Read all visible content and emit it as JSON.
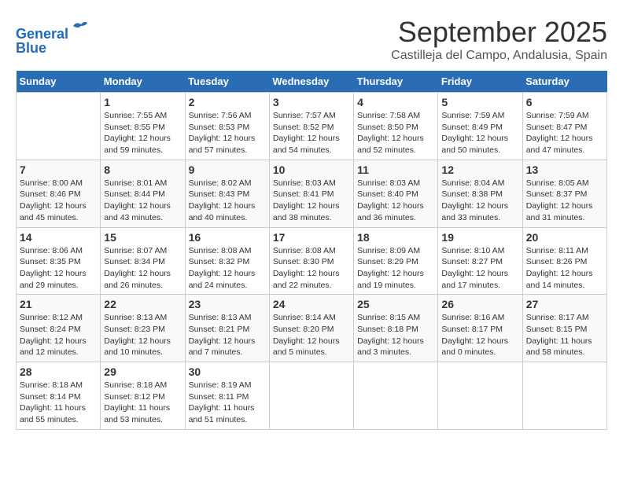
{
  "header": {
    "logo_line1": "General",
    "logo_line2": "Blue",
    "month_title": "September 2025",
    "location": "Castilleja del Campo, Andalusia, Spain"
  },
  "weekdays": [
    "Sunday",
    "Monday",
    "Tuesday",
    "Wednesday",
    "Thursday",
    "Friday",
    "Saturday"
  ],
  "weeks": [
    [
      {
        "day": "",
        "sunrise": "",
        "sunset": "",
        "daylight": ""
      },
      {
        "day": "1",
        "sunrise": "Sunrise: 7:55 AM",
        "sunset": "Sunset: 8:55 PM",
        "daylight": "Daylight: 12 hours and 59 minutes."
      },
      {
        "day": "2",
        "sunrise": "Sunrise: 7:56 AM",
        "sunset": "Sunset: 8:53 PM",
        "daylight": "Daylight: 12 hours and 57 minutes."
      },
      {
        "day": "3",
        "sunrise": "Sunrise: 7:57 AM",
        "sunset": "Sunset: 8:52 PM",
        "daylight": "Daylight: 12 hours and 54 minutes."
      },
      {
        "day": "4",
        "sunrise": "Sunrise: 7:58 AM",
        "sunset": "Sunset: 8:50 PM",
        "daylight": "Daylight: 12 hours and 52 minutes."
      },
      {
        "day": "5",
        "sunrise": "Sunrise: 7:59 AM",
        "sunset": "Sunset: 8:49 PM",
        "daylight": "Daylight: 12 hours and 50 minutes."
      },
      {
        "day": "6",
        "sunrise": "Sunrise: 7:59 AM",
        "sunset": "Sunset: 8:47 PM",
        "daylight": "Daylight: 12 hours and 47 minutes."
      }
    ],
    [
      {
        "day": "7",
        "sunrise": "Sunrise: 8:00 AM",
        "sunset": "Sunset: 8:46 PM",
        "daylight": "Daylight: 12 hours and 45 minutes."
      },
      {
        "day": "8",
        "sunrise": "Sunrise: 8:01 AM",
        "sunset": "Sunset: 8:44 PM",
        "daylight": "Daylight: 12 hours and 43 minutes."
      },
      {
        "day": "9",
        "sunrise": "Sunrise: 8:02 AM",
        "sunset": "Sunset: 8:43 PM",
        "daylight": "Daylight: 12 hours and 40 minutes."
      },
      {
        "day": "10",
        "sunrise": "Sunrise: 8:03 AM",
        "sunset": "Sunset: 8:41 PM",
        "daylight": "Daylight: 12 hours and 38 minutes."
      },
      {
        "day": "11",
        "sunrise": "Sunrise: 8:03 AM",
        "sunset": "Sunset: 8:40 PM",
        "daylight": "Daylight: 12 hours and 36 minutes."
      },
      {
        "day": "12",
        "sunrise": "Sunrise: 8:04 AM",
        "sunset": "Sunset: 8:38 PM",
        "daylight": "Daylight: 12 hours and 33 minutes."
      },
      {
        "day": "13",
        "sunrise": "Sunrise: 8:05 AM",
        "sunset": "Sunset: 8:37 PM",
        "daylight": "Daylight: 12 hours and 31 minutes."
      }
    ],
    [
      {
        "day": "14",
        "sunrise": "Sunrise: 8:06 AM",
        "sunset": "Sunset: 8:35 PM",
        "daylight": "Daylight: 12 hours and 29 minutes."
      },
      {
        "day": "15",
        "sunrise": "Sunrise: 8:07 AM",
        "sunset": "Sunset: 8:34 PM",
        "daylight": "Daylight: 12 hours and 26 minutes."
      },
      {
        "day": "16",
        "sunrise": "Sunrise: 8:08 AM",
        "sunset": "Sunset: 8:32 PM",
        "daylight": "Daylight: 12 hours and 24 minutes."
      },
      {
        "day": "17",
        "sunrise": "Sunrise: 8:08 AM",
        "sunset": "Sunset: 8:30 PM",
        "daylight": "Daylight: 12 hours and 22 minutes."
      },
      {
        "day": "18",
        "sunrise": "Sunrise: 8:09 AM",
        "sunset": "Sunset: 8:29 PM",
        "daylight": "Daylight: 12 hours and 19 minutes."
      },
      {
        "day": "19",
        "sunrise": "Sunrise: 8:10 AM",
        "sunset": "Sunset: 8:27 PM",
        "daylight": "Daylight: 12 hours and 17 minutes."
      },
      {
        "day": "20",
        "sunrise": "Sunrise: 8:11 AM",
        "sunset": "Sunset: 8:26 PM",
        "daylight": "Daylight: 12 hours and 14 minutes."
      }
    ],
    [
      {
        "day": "21",
        "sunrise": "Sunrise: 8:12 AM",
        "sunset": "Sunset: 8:24 PM",
        "daylight": "Daylight: 12 hours and 12 minutes."
      },
      {
        "day": "22",
        "sunrise": "Sunrise: 8:13 AM",
        "sunset": "Sunset: 8:23 PM",
        "daylight": "Daylight: 12 hours and 10 minutes."
      },
      {
        "day": "23",
        "sunrise": "Sunrise: 8:13 AM",
        "sunset": "Sunset: 8:21 PM",
        "daylight": "Daylight: 12 hours and 7 minutes."
      },
      {
        "day": "24",
        "sunrise": "Sunrise: 8:14 AM",
        "sunset": "Sunset: 8:20 PM",
        "daylight": "Daylight: 12 hours and 5 minutes."
      },
      {
        "day": "25",
        "sunrise": "Sunrise: 8:15 AM",
        "sunset": "Sunset: 8:18 PM",
        "daylight": "Daylight: 12 hours and 3 minutes."
      },
      {
        "day": "26",
        "sunrise": "Sunrise: 8:16 AM",
        "sunset": "Sunset: 8:17 PM",
        "daylight": "Daylight: 12 hours and 0 minutes."
      },
      {
        "day": "27",
        "sunrise": "Sunrise: 8:17 AM",
        "sunset": "Sunset: 8:15 PM",
        "daylight": "Daylight: 11 hours and 58 minutes."
      }
    ],
    [
      {
        "day": "28",
        "sunrise": "Sunrise: 8:18 AM",
        "sunset": "Sunset: 8:14 PM",
        "daylight": "Daylight: 11 hours and 55 minutes."
      },
      {
        "day": "29",
        "sunrise": "Sunrise: 8:18 AM",
        "sunset": "Sunset: 8:12 PM",
        "daylight": "Daylight: 11 hours and 53 minutes."
      },
      {
        "day": "30",
        "sunrise": "Sunrise: 8:19 AM",
        "sunset": "Sunset: 8:11 PM",
        "daylight": "Daylight: 11 hours and 51 minutes."
      },
      {
        "day": "",
        "sunrise": "",
        "sunset": "",
        "daylight": ""
      },
      {
        "day": "",
        "sunrise": "",
        "sunset": "",
        "daylight": ""
      },
      {
        "day": "",
        "sunrise": "",
        "sunset": "",
        "daylight": ""
      },
      {
        "day": "",
        "sunrise": "",
        "sunset": "",
        "daylight": ""
      }
    ]
  ]
}
